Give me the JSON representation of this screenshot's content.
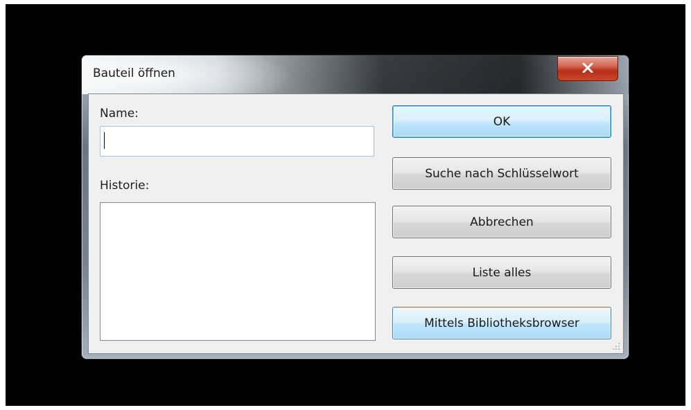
{
  "window": {
    "title": "Bauteil öffnen",
    "close_icon": "close-icon"
  },
  "form": {
    "name_label": "Name:",
    "name_value": "",
    "history_label": "Historie:",
    "history_items": []
  },
  "buttons": {
    "ok": "OK",
    "keyword_search": "Suche nach Schlüsselwort",
    "cancel": "Abbrechen",
    "list_all": "Liste alles",
    "library_browser": "Mittels Bibliotheksbrowser"
  },
  "colors": {
    "client_background": "#f0f0f0",
    "default_button_accent": "#3c7fb1",
    "close_button": "#c9482c"
  }
}
